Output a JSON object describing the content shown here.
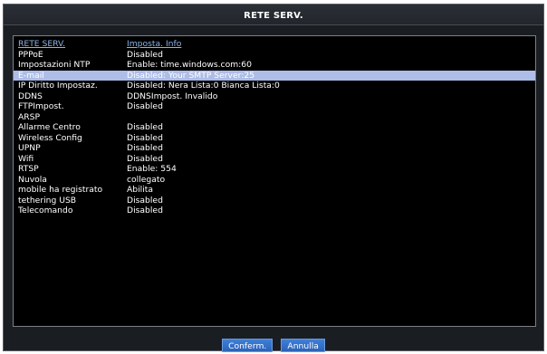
{
  "window": {
    "title": "RETE SERV."
  },
  "table": {
    "headers": [
      "RETE SERV.",
      "Imposta. Info"
    ],
    "rows": [
      {
        "name": "PPPoE",
        "info": "Disabled"
      },
      {
        "name": "Impostazioni NTP",
        "info": "Enable: time.windows.com:60"
      },
      {
        "name": "E-mail",
        "info": "Disabled: Your SMTP Server:25",
        "selected": true
      },
      {
        "name": "IP Diritto Impostaz.",
        "info": "Disabled: Nera Lista:0 Bianca Lista:0"
      },
      {
        "name": "DDNS",
        "info": "DDNSImpost. Invalido"
      },
      {
        "name": "FTPImpost.",
        "info": "Disabled"
      },
      {
        "name": "ARSP",
        "info": ""
      },
      {
        "name": "Allarme Centro",
        "info": "Disabled"
      },
      {
        "name": "Wireless Config",
        "info": "Disabled"
      },
      {
        "name": "UPNP",
        "info": "Disabled"
      },
      {
        "name": "Wifi",
        "info": "Disabled"
      },
      {
        "name": "RTSP",
        "info": "Enable: 554"
      },
      {
        "name": "Nuvola",
        "info": "collegato"
      },
      {
        "name": "mobile ha registrato",
        "info": "Abilita"
      },
      {
        "name": "tethering USB",
        "info": "Disabled"
      },
      {
        "name": "Telecomando",
        "info": "Disabled"
      }
    ]
  },
  "buttons": {
    "confirm": "Conferm.",
    "cancel": "Annulla"
  },
  "colors": {
    "header_text": "#8fb3e8",
    "selected_row": "#aebde8",
    "button": "#2f6fcb",
    "window_bg": "#1a1d22",
    "panel_bg": "#000000"
  }
}
